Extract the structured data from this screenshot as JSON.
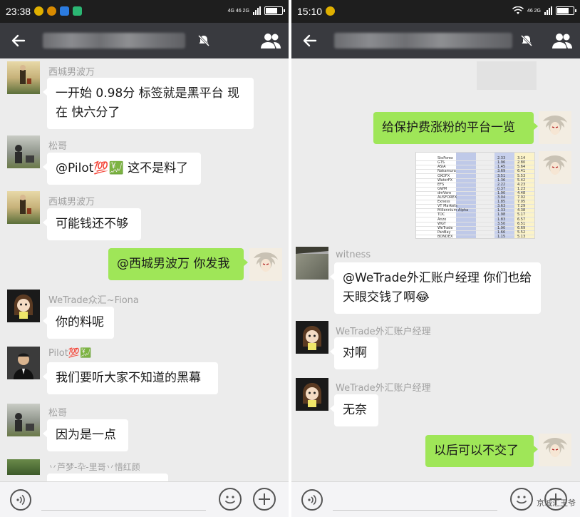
{
  "left_screen": {
    "status": {
      "time": "23:38",
      "signal_text": "4G 46 2G"
    },
    "messages": [
      {
        "sender": "西城男波万",
        "text": "一开始   0.98分 标签就是黑平台 现\n在 快六分了",
        "direction": "in"
      },
      {
        "sender": "松哥",
        "text": "@Pilot💯💹 这不是料了",
        "direction": "in"
      },
      {
        "sender": "西城男波万",
        "text": "可能钱还不够",
        "direction": "in"
      },
      {
        "sender": "",
        "text": "@西城男波万 你发我",
        "direction": "out"
      },
      {
        "sender": "WeTrade众汇~Fiona",
        "text": "你的料呢",
        "direction": "in"
      },
      {
        "sender": "Pilot💯💹",
        "text": "我们要听大家不知道的黑幕",
        "direction": "in"
      },
      {
        "sender": "松哥",
        "text": "因为是一点",
        "direction": "in"
      },
      {
        "sender": "丷芦梦-卆-里哥丷惜红颜",
        "text": "",
        "direction": "in"
      }
    ]
  },
  "right_screen": {
    "status": {
      "time": "15:10",
      "signal_text": "46 2G"
    },
    "messages": [
      {
        "sender": "",
        "text": "给保护费涨粉的平台一览",
        "direction": "out"
      },
      {
        "sender": "witness",
        "text": "@WeTrade外汇账户经理 你们也给\n天眼交钱了啊😂",
        "direction": "in"
      },
      {
        "sender": "WeTrade外汇账户经理",
        "text": "对啊",
        "direction": "in"
      },
      {
        "sender": "WeTrade外汇账户经理",
        "text": "无奈",
        "direction": "in"
      },
      {
        "sender": "",
        "text": "以后可以不交了",
        "direction": "out"
      }
    ],
    "table_image": {
      "rows": [
        {
          "name": "StoForex",
          "b": "2.33",
          "c": "3.14"
        },
        {
          "name": "GTS",
          "b": "1.96",
          "c": "2.80"
        },
        {
          "name": "ASIA",
          "b": "1.45",
          "b2": "5.64",
          "c": "5.64"
        },
        {
          "name": "Nakamura",
          "b": "3.69",
          "c": "6.41"
        },
        {
          "name": "OXDFX",
          "b": "3.51",
          "c": "5.53"
        },
        {
          "name": "WaterFX",
          "b": "1.36",
          "c": "5.42"
        },
        {
          "name": "EFS",
          "b": "2.22",
          "c": "4.23"
        },
        {
          "name": "GWM",
          "b": "0.37",
          "c": "1.23"
        },
        {
          "name": "dmVere",
          "b": "1.90",
          "c": "4.48"
        },
        {
          "name": "AUSFOREX",
          "b": "3.04",
          "c": "7.02"
        },
        {
          "name": "Exness",
          "b": "1.85",
          "c": "7.05"
        },
        {
          "name": "VT Markets",
          "b": "3.63",
          "c": "7.29"
        },
        {
          "name": "Millennium Alpha",
          "b": "1.33",
          "c": "4.38"
        },
        {
          "name": "TDC",
          "b": "1.98",
          "c": "5.17"
        },
        {
          "name": "Anzo",
          "b": "1.83",
          "c": "6.57"
        },
        {
          "name": "WGT",
          "b": "3.50",
          "c": "6.51"
        },
        {
          "name": "WeTrade",
          "b": "1.90",
          "c": "6.69"
        },
        {
          "name": "PanBay",
          "b": "1.66",
          "c": "5.52"
        },
        {
          "name": "BONDEX",
          "b": "1.15",
          "c": "5.13"
        }
      ]
    }
  },
  "bottom": {
    "watermark": "京城汇王爷"
  },
  "colors": {
    "titlebar": "#393a3f",
    "statusbar": "#1e1e1e",
    "chat_bg": "#ececec",
    "out_bubble": "#9fe658",
    "in_bubble": "#ffffff"
  }
}
